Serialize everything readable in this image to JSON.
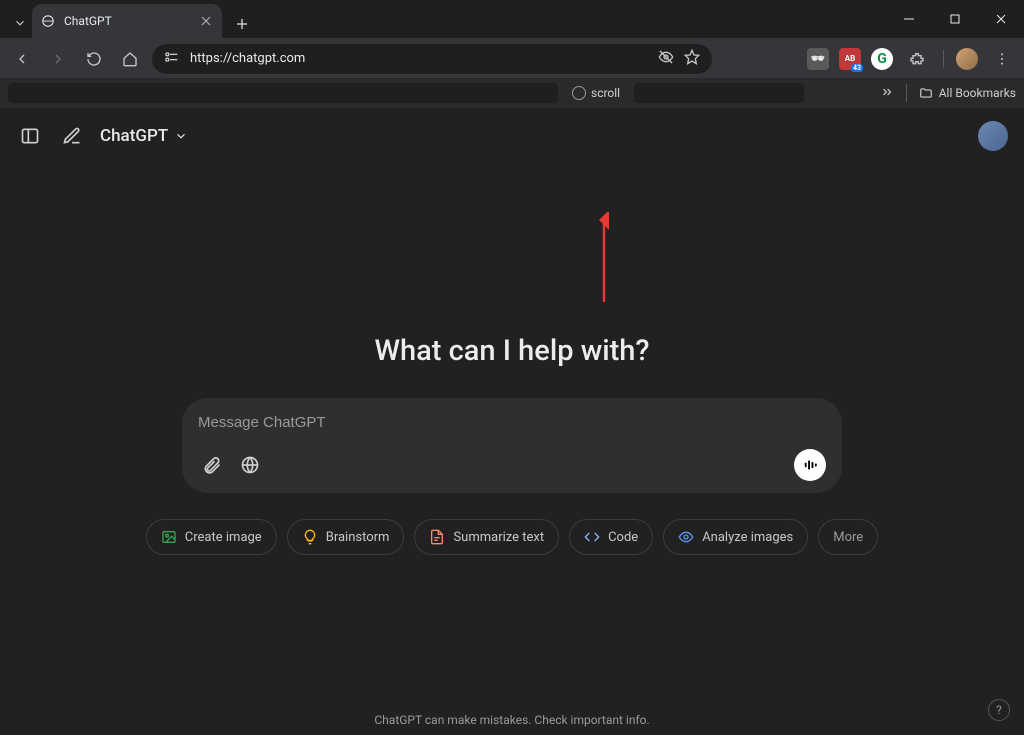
{
  "browser": {
    "tab_title": "ChatGPT",
    "url": "https://chatgpt.com",
    "bookmark_item": "scroll",
    "all_bookmarks": "All Bookmarks",
    "ext_badge": "43"
  },
  "app": {
    "model": "ChatGPT",
    "hero": "What can I help with?",
    "placeholder": "Message ChatGPT",
    "chips": {
      "create_image": "Create image",
      "brainstorm": "Brainstorm",
      "summarize": "Summarize text",
      "code": "Code",
      "analyze": "Analyze images",
      "more": "More"
    },
    "footer": "ChatGPT can make mistakes. Check important info.",
    "help": "?"
  },
  "colors": {
    "chip_create": "#34a853",
    "chip_brainstorm": "#fbbc04",
    "chip_summarize": "#ff8a65",
    "chip_code": "#8ab4f8",
    "chip_analyze": "#5e97f6"
  }
}
